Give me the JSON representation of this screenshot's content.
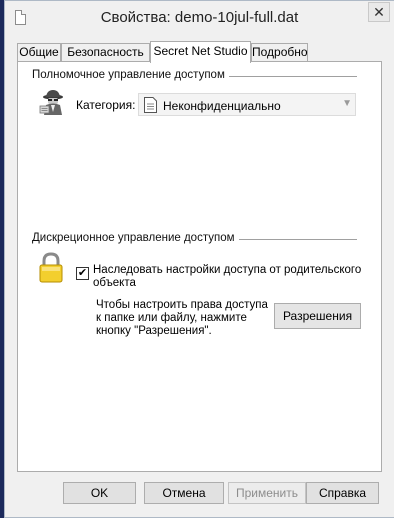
{
  "window": {
    "title": "Свойства: demo-10jul-full.dat",
    "close_glyph": "✕"
  },
  "tabs": [
    {
      "label": "Общие"
    },
    {
      "label": "Безопасность"
    },
    {
      "label": "Secret Net Studio",
      "active": true
    },
    {
      "label": "Подробно"
    }
  ],
  "mandatory": {
    "group_title": "Полномочное управление доступом",
    "category_label": "Категория:",
    "category_value": "Неконфиденциально"
  },
  "discretionary": {
    "group_title": "Дискреционное управление доступом",
    "inherit_label": "Наследовать настройки доступа от родительского объекта",
    "inherit_checked": true,
    "hint": "Чтобы настроить права доступа к папке или файлу, нажмите кнопку \"Разрешения\".",
    "permissions_button": "Разрешения"
  },
  "footer": {
    "ok": "OK",
    "cancel": "Отмена",
    "apply": "Применить",
    "help": "Справка"
  }
}
